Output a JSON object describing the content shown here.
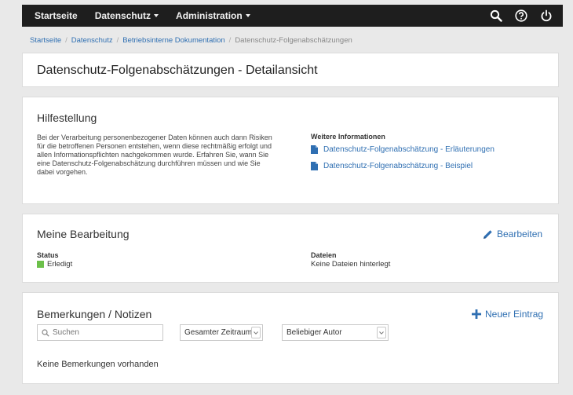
{
  "navbar": {
    "items": [
      {
        "label": "Startseite",
        "dropdown": false
      },
      {
        "label": "Datenschutz",
        "dropdown": true
      },
      {
        "label": "Administration",
        "dropdown": true
      }
    ],
    "icons": [
      "search-icon",
      "help-icon",
      "power-icon"
    ]
  },
  "breadcrumb": {
    "items": [
      "Startseite",
      "Datenschutz",
      "Betriebsinterne Dokumentation"
    ],
    "current": "Datenschutz-Folgenabschätzungen"
  },
  "page": {
    "title": "Datenschutz-Folgenabschätzungen - Detailansicht"
  },
  "help": {
    "title": "Hilfestellung",
    "text": "Bei der Verarbeitung personenbezogener Daten können auch dann Risiken für die betroffenen Personen entstehen, wenn diese rechtmäßig erfolgt und allen Informationspflichten nachgekommen wurde. Erfahren Sie, wann Sie eine Datenschutz-Folgenabschätzung durchführen müssen und wie Sie dabei vorgehen.",
    "more_info_title": "Weitere Informationen",
    "links": [
      "Datenschutz-Folgenabschätzung - Erläuterungen",
      "Datenschutz-Folgenabschätzung - Beispiel"
    ]
  },
  "edit": {
    "title": "Meine Bearbeitung",
    "edit_label": "Bearbeiten",
    "status_label": "Status",
    "status_value": "Erledigt",
    "status_color": "#6cc04a",
    "files_label": "Dateien",
    "files_value": "Keine Dateien hinterlegt"
  },
  "notes": {
    "title": "Bemerkungen / Notizen",
    "new_entry_label": "Neuer Eintrag",
    "search_placeholder": "Suchen",
    "period_value": "Gesamter Zeitraum",
    "author_value": "Beliebiger Autor",
    "empty_text": "Keine Bemerkungen vorhanden"
  },
  "colors": {
    "navbar_bg": "#1e1e1e",
    "link": "#2f6fb2",
    "page_bg": "#e9e9e9"
  }
}
